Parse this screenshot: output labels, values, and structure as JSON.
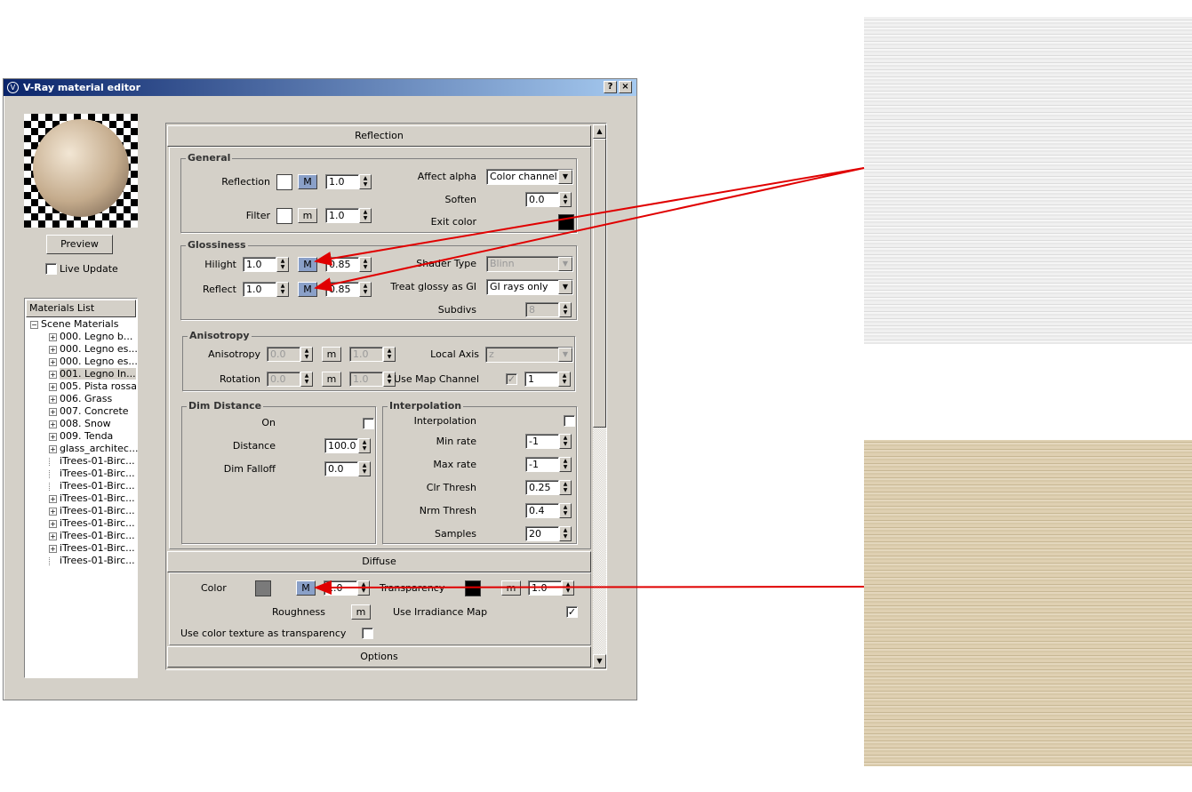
{
  "window": {
    "title": "V-Ray material editor",
    "help": "?",
    "close": "×"
  },
  "left": {
    "preview_button": "Preview",
    "live_update_label": "Live Update",
    "materials_header": "Materials List",
    "tree_root": "Scene Materials",
    "materials": [
      {
        "label": "000. Legno b...",
        "expand": true
      },
      {
        "label": "000. Legno es...",
        "expand": true
      },
      {
        "label": "000. Legno es...",
        "expand": true
      },
      {
        "label": "001. Legno In...",
        "expand": true,
        "selected": true
      },
      {
        "label": "005. Pista rossa",
        "expand": true
      },
      {
        "label": "006. Grass",
        "expand": true
      },
      {
        "label": "007. Concrete",
        "expand": true
      },
      {
        "label": "008. Snow",
        "expand": true
      },
      {
        "label": "009. Tenda",
        "expand": true
      },
      {
        "label": "glass_architec...",
        "expand": true
      },
      {
        "label": "iTrees-01-Birc...",
        "expand": false
      },
      {
        "label": "iTrees-01-Birc...",
        "expand": false
      },
      {
        "label": "iTrees-01-Birc...",
        "expand": false
      },
      {
        "label": "iTrees-01-Birc...",
        "expand": true
      },
      {
        "label": "iTrees-01-Birc...",
        "expand": true
      },
      {
        "label": "iTrees-01-Birc...",
        "expand": true
      },
      {
        "label": "iTrees-01-Birc...",
        "expand": true
      },
      {
        "label": "iTrees-01-Birc...",
        "expand": true
      },
      {
        "label": "iTrees-01-Birc...",
        "expand": false
      }
    ]
  },
  "reflection": {
    "header": "Reflection",
    "general": {
      "title": "General",
      "reflection_label": "Reflection",
      "reflection_m": "M",
      "reflection_value": "1.0",
      "filter_label": "Filter",
      "filter_m": "m",
      "filter_value": "1.0",
      "affect_alpha_label": "Affect alpha",
      "affect_alpha_value": "Color channel or",
      "soften_label": "Soften",
      "soften_value": "0.0",
      "exit_color_label": "Exit color"
    },
    "glossiness": {
      "title": "Glossiness",
      "hilight_label": "Hilight",
      "hilight_value": "1.0",
      "hilight_m": "M",
      "hilight_gloss": "0.85",
      "reflect_label": "Reflect",
      "reflect_value": "1.0",
      "reflect_m": "M",
      "reflect_gloss": "0.85",
      "shader_type_label": "Shader Type",
      "shader_type_value": "Blinn",
      "treat_glossy_label": "Treat glossy as GI",
      "treat_glossy_value": "GI rays only",
      "subdivs_label": "Subdivs",
      "subdivs_value": "8"
    },
    "anisotropy": {
      "title": "Anisotropy",
      "anisotropy_label": "Anisotropy",
      "anisotropy_value": "0.0",
      "anisotropy_m": "m",
      "anisotropy_amount": "1.0",
      "rotation_label": "Rotation",
      "rotation_value": "0.0",
      "rotation_m": "m",
      "rotation_amount": "1.0",
      "local_axis_label": "Local Axis",
      "local_axis_value": "z",
      "map_channel_label": "Use Map Channel",
      "map_channel_value": "1"
    },
    "dim": {
      "title": "Dim Distance",
      "on_label": "On",
      "distance_label": "Distance",
      "distance_value": "100.0",
      "falloff_label": "Dim Falloff",
      "falloff_value": "0.0"
    },
    "interp": {
      "title": "Interpolation",
      "interp_label": "Interpolation",
      "min_rate_label": "Min rate",
      "min_rate_value": "-1",
      "max_rate_label": "Max rate",
      "max_rate_value": "-1",
      "clr_label": "Clr Thresh",
      "clr_value": "0.25",
      "nrm_label": "Nrm Thresh",
      "nrm_value": "0.4",
      "samples_label": "Samples",
      "samples_value": "20"
    }
  },
  "diffuse": {
    "header": "Diffuse",
    "color_label": "Color",
    "color_m": "M",
    "color_value": "1.0",
    "transparency_label": "Transparency",
    "transparency_m": "m",
    "transparency_value": "1.0",
    "roughness_label": "Roughness",
    "roughness_m": "m",
    "irradiance_label": "Use Irradiance Map",
    "color_tex_label": "Use color texture as transparency"
  },
  "options": {
    "header": "Options"
  },
  "colors": {
    "arrow": "#e00000",
    "title_start": "#0a246a",
    "title_end": "#a6caf0",
    "m_active": "#8aa0c8"
  }
}
